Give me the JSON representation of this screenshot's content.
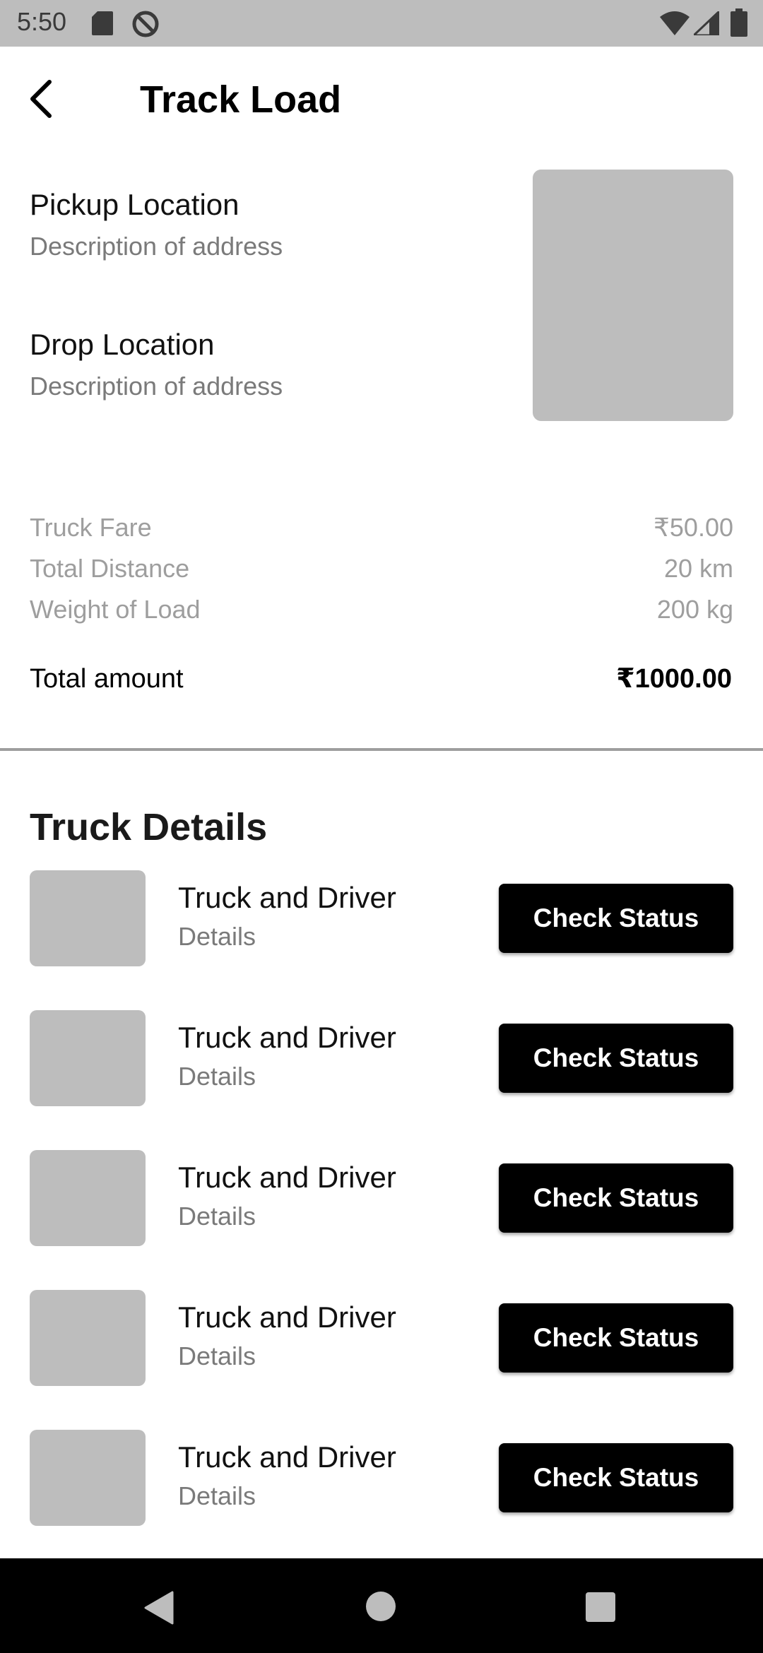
{
  "status_bar": {
    "time": "5:50",
    "icons": [
      "sd-card-icon",
      "do-not-disturb-icon",
      "wifi-icon",
      "cellular-signal-icon",
      "battery-icon"
    ]
  },
  "header": {
    "title": "Track Load",
    "back_icon": "arrow-back-icon"
  },
  "locations": {
    "pickup": {
      "title": "Pickup Location",
      "description": "Description of address"
    },
    "drop": {
      "title": "Drop Location",
      "description": "Description of address"
    }
  },
  "fares": {
    "items": [
      {
        "label": "Truck Fare",
        "value": "₹50.00"
      },
      {
        "label": "Total Distance",
        "value": "20 km"
      },
      {
        "label": "Weight of Load",
        "value": "200 kg"
      }
    ],
    "total": {
      "label": "Total amount",
      "value": "₹1000.00"
    }
  },
  "trucks": {
    "title": "Truck Details",
    "items": [
      {
        "name": "Truck and Driver",
        "details": "Details",
        "button": "Check Status"
      },
      {
        "name": "Truck and Driver",
        "details": "Details",
        "button": "Check Status"
      },
      {
        "name": "Truck and Driver",
        "details": "Details",
        "button": "Check Status"
      },
      {
        "name": "Truck and Driver",
        "details": "Details",
        "button": "Check Status"
      },
      {
        "name": "Truck and Driver",
        "details": "Details",
        "button": "Check Status"
      }
    ]
  },
  "colors": {
    "placeholder": "#bdbdbd",
    "button_bg": "#000000",
    "button_text": "#ffffff",
    "muted_text": "#9e9e9e"
  },
  "nav_bar": {
    "icons": [
      "nav-back-icon",
      "nav-home-icon",
      "nav-recents-icon"
    ]
  }
}
